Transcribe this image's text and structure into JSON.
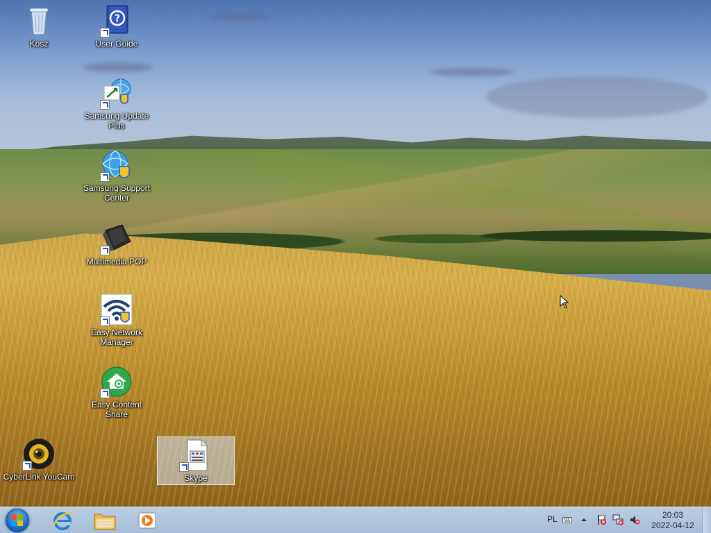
{
  "desktop": {
    "icons": [
      {
        "label": "Kosz",
        "icon": "recycle-bin-icon"
      },
      {
        "label": "User Guide",
        "icon": "user-guide-icon"
      },
      {
        "label": "Samsung Update Plus",
        "icon": "samsung-update-icon"
      },
      {
        "label": "Samsung Support Center",
        "icon": "samsung-support-icon"
      },
      {
        "label": "Multimedia POP",
        "icon": "multimedia-pop-icon"
      },
      {
        "label": "Easy Network Manager",
        "icon": "network-manager-icon"
      },
      {
        "label": "Easy Content Share",
        "icon": "content-share-icon"
      },
      {
        "label": "CyberLink YouCam",
        "icon": "webcam-icon"
      },
      {
        "label": "Skype",
        "icon": "skype-file-icon",
        "selected": true
      }
    ]
  },
  "taskbar": {
    "start": {
      "icon": "windows-start-icon"
    },
    "pinned": [
      {
        "name": "Internet Explorer",
        "icon": "internet-explorer-icon"
      },
      {
        "name": "File Explorer",
        "icon": "folder-icon"
      },
      {
        "name": "Media Player",
        "icon": "media-player-icon"
      }
    ],
    "tray": {
      "language": "PL",
      "icons": [
        "keyboard-icon",
        "show-hidden-icons-icon",
        "action-center-flag-icon",
        "network-icon",
        "volume-muted-icon"
      ],
      "time": "20:03",
      "date": "2022-04-12"
    }
  },
  "colors": {
    "taskbar_bg": "#b0c6de",
    "desktop_text": "#ffffff"
  }
}
